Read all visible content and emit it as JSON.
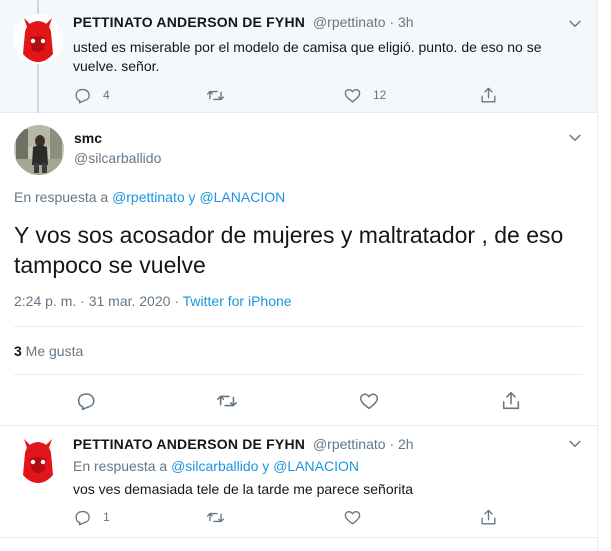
{
  "tweet1": {
    "name": "PETTINATO ANDERSON DE FYHN",
    "handle": "@rpettinato",
    "time_sep": " · ",
    "time": "3h",
    "text": "usted es miserable por el modelo de camisa que eligió. punto. de eso no se vuelve. señor.",
    "reply_count": "4",
    "retweet_count": "",
    "like_count": "12"
  },
  "tweet2": {
    "name": "smc",
    "handle": "@silcarballido",
    "reply_prefix": "En respuesta a ",
    "reply_user1": "@rpettinato",
    "reply_and": " y ",
    "reply_user2": "@LANACION",
    "text": "Y vos sos acosador de mujeres y maltratador , de eso tampoco se vuelve",
    "date": "2:24 p. m. · 31 mar. 2020",
    "date_sep": " · ",
    "source": "Twitter for iPhone",
    "likes_count": "3",
    "likes_label": " Me gusta"
  },
  "tweet3": {
    "name": "PETTINATO ANDERSON DE FYHN",
    "handle": "@rpettinato",
    "time_sep": " · ",
    "time": "2h",
    "reply_prefix": "En respuesta a ",
    "reply_user1": "@silcarballido",
    "reply_and": " y ",
    "reply_user2": "@LANACION",
    "text": "vos ves demasiada tele de la tarde me parece señorita",
    "reply_count": "1"
  },
  "colors": {
    "accent": "#1b95e0",
    "muted": "#657786",
    "text": "#14171a",
    "border": "#e6ecf0",
    "highlight_bg": "#f5f8fa"
  },
  "icons": {
    "reply": "reply-icon",
    "retweet": "retweet-icon",
    "like": "heart-icon",
    "share": "share-icon",
    "more": "chevron-down-icon"
  }
}
